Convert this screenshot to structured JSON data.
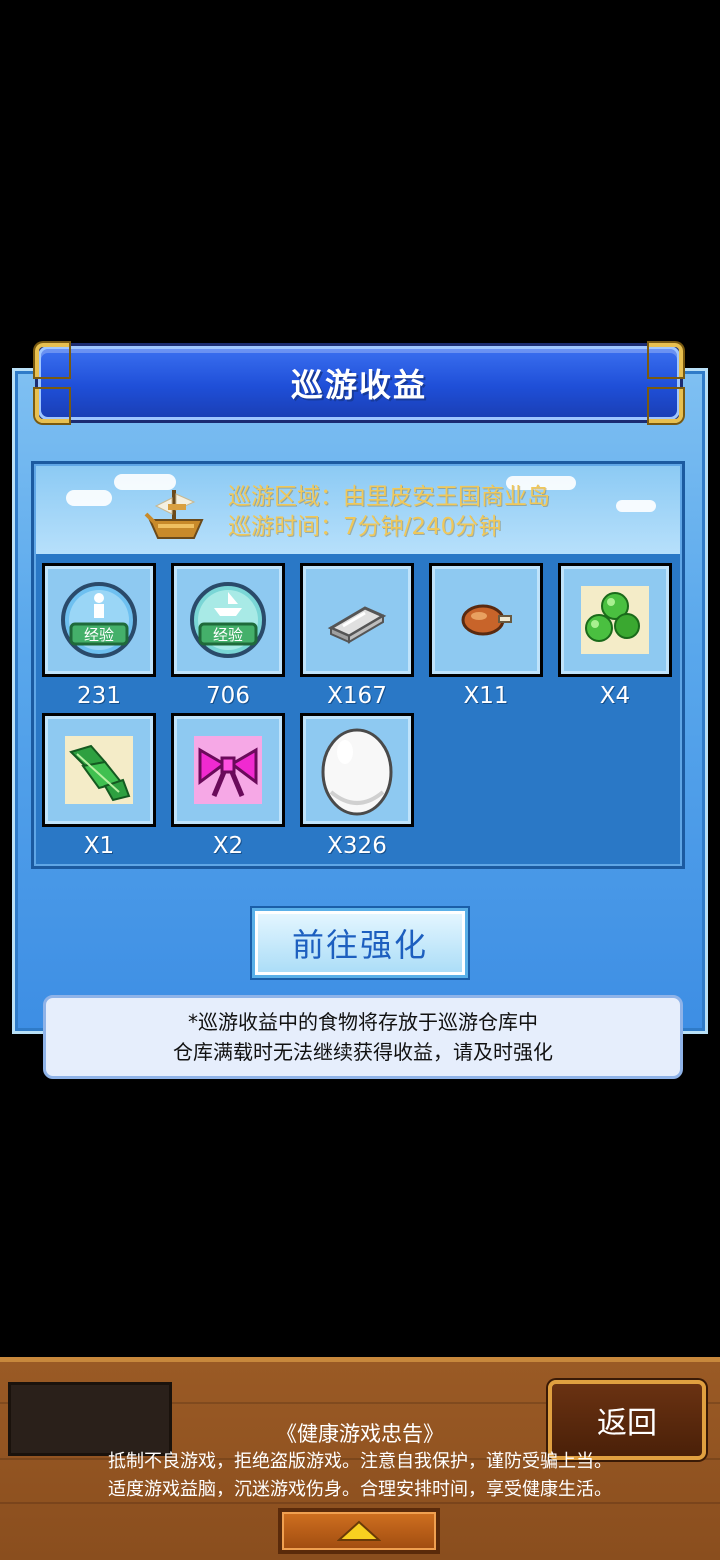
{
  "dialog": {
    "title": "巡游收益",
    "cruise_area": "巡游区域：由里皮安王国商业岛",
    "cruise_time": "巡游时间：7分钟/240分钟",
    "items": [
      {
        "icon": "exp-bubble-person-icon",
        "qty": "231"
      },
      {
        "icon": "exp-bubble-ship-icon",
        "qty": "706"
      },
      {
        "icon": "silver-ingot-icon",
        "qty": "X167"
      },
      {
        "icon": "roast-meat-icon",
        "qty": "X11"
      },
      {
        "icon": "green-peas-icon",
        "qty": "X4"
      },
      {
        "icon": "leafy-greens-icon",
        "qty": "X1"
      },
      {
        "icon": "pink-bow-icon",
        "qty": "X2"
      },
      {
        "icon": "white-egg-icon",
        "qty": "X326"
      }
    ],
    "enhance_label": "前往强化",
    "note_line1": "*巡游收益中的食物将存放于巡游仓库中",
    "note_line2": "仓库满载时无法继续获得收益，请及时强化",
    "exp_badge": "经验"
  },
  "bottom": {
    "back_label": "返回",
    "notice_title": "《健康游戏忠告》",
    "notice_line1": "抵制不良游戏，拒绝盗版游戏。注意自我保护，谨防受骗上当。",
    "notice_line2": "适度游戏益脑，沉迷游戏伤身。合理安排时间，享受健康生活。"
  }
}
